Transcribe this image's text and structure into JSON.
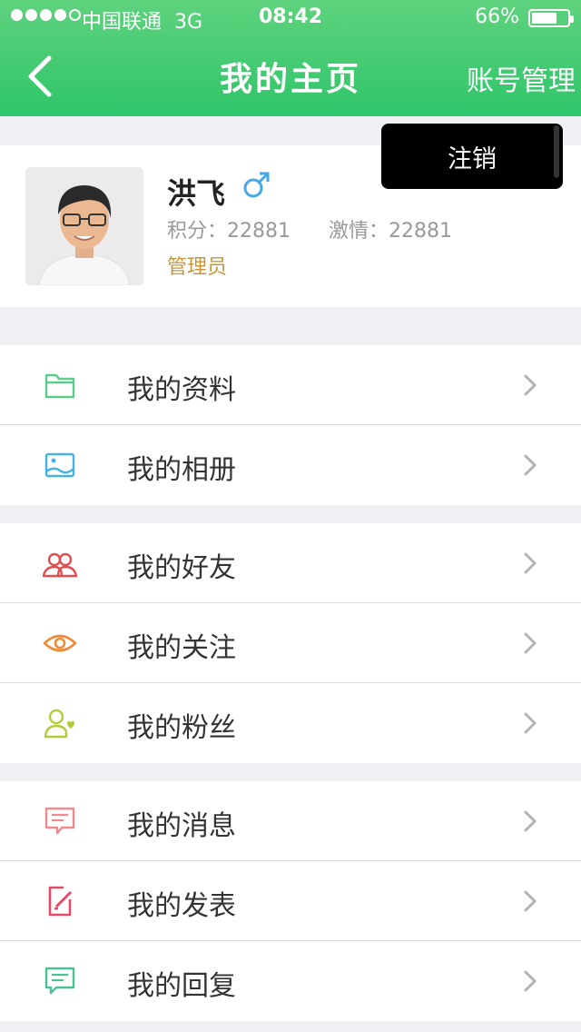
{
  "status_bar": {
    "carrier": "中国联通",
    "network": "3G",
    "time": "08:42",
    "battery": "66%",
    "battery_level": 0.66
  },
  "nav": {
    "title": "我的主页",
    "right_action": "账号管理",
    "back_icon": "chevron-left-icon"
  },
  "popup": {
    "logout": "注销"
  },
  "profile": {
    "name": "洪飞",
    "gender_icon": "male-icon",
    "points_label": "积分：",
    "points_value": "22881",
    "passion_label": "激情：",
    "passion_value": "22881",
    "role": "管理员"
  },
  "menu": {
    "group1": [
      {
        "label": "我的资料",
        "icon": "folder-icon",
        "color": "#5ccc8c"
      },
      {
        "label": "我的相册",
        "icon": "picture-icon",
        "color": "#45b2e6"
      }
    ],
    "group2": [
      {
        "label": "我的好友",
        "icon": "friends-icon",
        "color": "#e05050"
      },
      {
        "label": "我的关注",
        "icon": "eye-icon",
        "color": "#ec8a35"
      },
      {
        "label": "我的粉丝",
        "icon": "fan-user-icon",
        "color": "#b0cc3a"
      }
    ],
    "group3": [
      {
        "label": "我的消息",
        "icon": "message-icon",
        "color": "#ef8a8f"
      },
      {
        "label": "我的发表",
        "icon": "edit-icon",
        "color": "#e44a68"
      },
      {
        "label": "我的回复",
        "icon": "reply-icon",
        "color": "#48c290"
      }
    ]
  },
  "colors": {
    "header": "#3ecb70",
    "role_text": "#c8963a"
  }
}
